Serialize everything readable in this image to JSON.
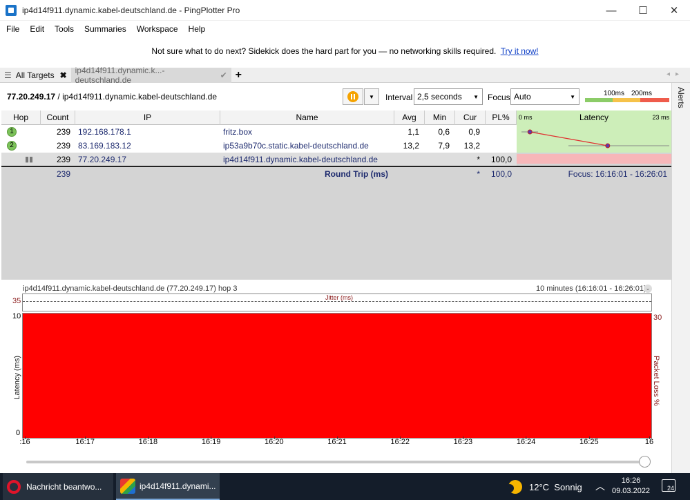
{
  "window": {
    "title": "ip4d14f911.dynamic.kabel-deutschland.de - PingPlotter Pro",
    "minimize_glyph": "—",
    "maximize_glyph": "☐",
    "close_glyph": "✕"
  },
  "menu": [
    "File",
    "Edit",
    "Tools",
    "Summaries",
    "Workspace",
    "Help"
  ],
  "banner": {
    "text": "Not sure what to do next? Sidekick does the hard part for you — no networking skills required.",
    "link": "Try it now!"
  },
  "tabs": {
    "all_targets": "All Targets",
    "host": "ip4d14f911.dynamic.k...-deutschland.de"
  },
  "alerts_label": "Alerts",
  "target": {
    "ip": "77.20.249.17",
    "host": "ip4d14f911.dynamic.kabel-deutschland.de"
  },
  "toolbar": {
    "interval_label": "Interval",
    "interval_value": "2,5 seconds",
    "focus_label": "Focus",
    "focus_value": "Auto",
    "scale_100": "100ms",
    "scale_200": "200ms"
  },
  "table": {
    "headers": [
      "Hop",
      "Count",
      "IP",
      "Name",
      "Avg",
      "Min",
      "Cur",
      "PL%"
    ],
    "latency_header": "Latency",
    "latency_min": "0 ms",
    "latency_max": "23 ms",
    "rows": [
      {
        "hop": "1",
        "count": "239",
        "ip": "192.168.178.1",
        "name": "fritz.box",
        "avg": "1,1",
        "min": "0,6",
        "cur": "0,9",
        "pl": ""
      },
      {
        "hop": "2",
        "count": "239",
        "ip": "83.169.183.12",
        "name": "ip53a9b70c.static.kabel-deutschland.de",
        "avg": "13,2",
        "min": "7,9",
        "cur": "13,2",
        "pl": ""
      },
      {
        "hop": "",
        "count": "239",
        "ip": "77.20.249.17",
        "name": "ip4d14f911.dynamic.kabel-deutschland.de",
        "avg": "",
        "min": "",
        "cur": "*",
        "pl": "100,0"
      }
    ],
    "round_trip": {
      "count": "239",
      "label": "Round Trip (ms)",
      "cur": "*",
      "pl": "100,0",
      "focus": "Focus: 16:16:01 - 16:26:01"
    },
    "latency_points_ms": [
      1.1,
      13.2
    ]
  },
  "timeline": {
    "target_label": "ip4d14f911.dynamic.kabel-deutschland.de (77.20.249.17) hop 3",
    "range": "10 minutes (16:16:01 - 16:26:01)",
    "jitter_label": "Jitter (ms)",
    "jitter_max": "35",
    "latency_max": "10",
    "latency_min": "0",
    "loss_max": "30",
    "ylabel_left": "Latency (ms)",
    "ylabel_right": "Packet Loss %",
    "ticks": [
      ":16",
      "16:17",
      "16:18",
      "16:19",
      "16:20",
      "16:21",
      "16:22",
      "16:23",
      "16:24",
      "16:25",
      "16"
    ],
    "packet_loss_color": "#ff0000"
  },
  "taskbar": {
    "opera_task": "Nachricht beantwo...",
    "pingplotter_task": "ip4d14f911.dynami...",
    "weather": "12°C  Sonnig",
    "time": "16:26",
    "date": "09.03.2022",
    "notifications": "24"
  }
}
